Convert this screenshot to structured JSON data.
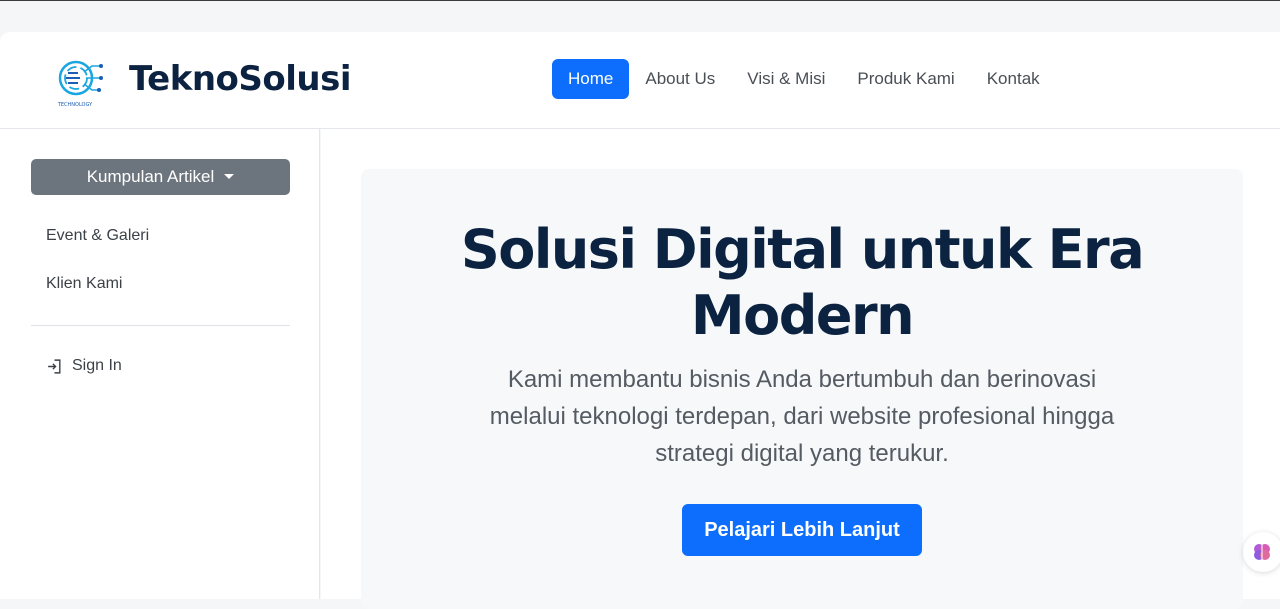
{
  "brand": {
    "name": "TeknoSolusi",
    "logo_icon": "circuit-brain-logo",
    "logo_caption": "TECHNOLOGY"
  },
  "nav": {
    "items": [
      {
        "label": "Home",
        "active": true
      },
      {
        "label": "About Us",
        "active": false
      },
      {
        "label": "Visi & Misi",
        "active": false
      },
      {
        "label": "Produk Kami",
        "active": false
      },
      {
        "label": "Kontak",
        "active": false
      }
    ]
  },
  "sidebar": {
    "dropdown_label": "Kumpulan Artikel",
    "links": [
      {
        "label": "Event & Galeri"
      },
      {
        "label": "Klien Kami"
      }
    ],
    "signin_label": "Sign In",
    "signin_icon": "sign-in-icon"
  },
  "hero": {
    "title": "Solusi Digital untuk Era Modern",
    "subtitle": "Kami membantu bisnis Anda bertumbuh dan berinovasi melalui teknologi terdepan, dari website profesional hingga strategi digital yang terukur.",
    "cta_label": "Pelajari Lebih Lanjut"
  },
  "floating_widget": {
    "icon": "brain-icon"
  },
  "colors": {
    "primary": "#0d6efd",
    "brand_dark": "#0b2240",
    "secondary": "#6c757d",
    "hero_bg": "#f6f8fa"
  }
}
